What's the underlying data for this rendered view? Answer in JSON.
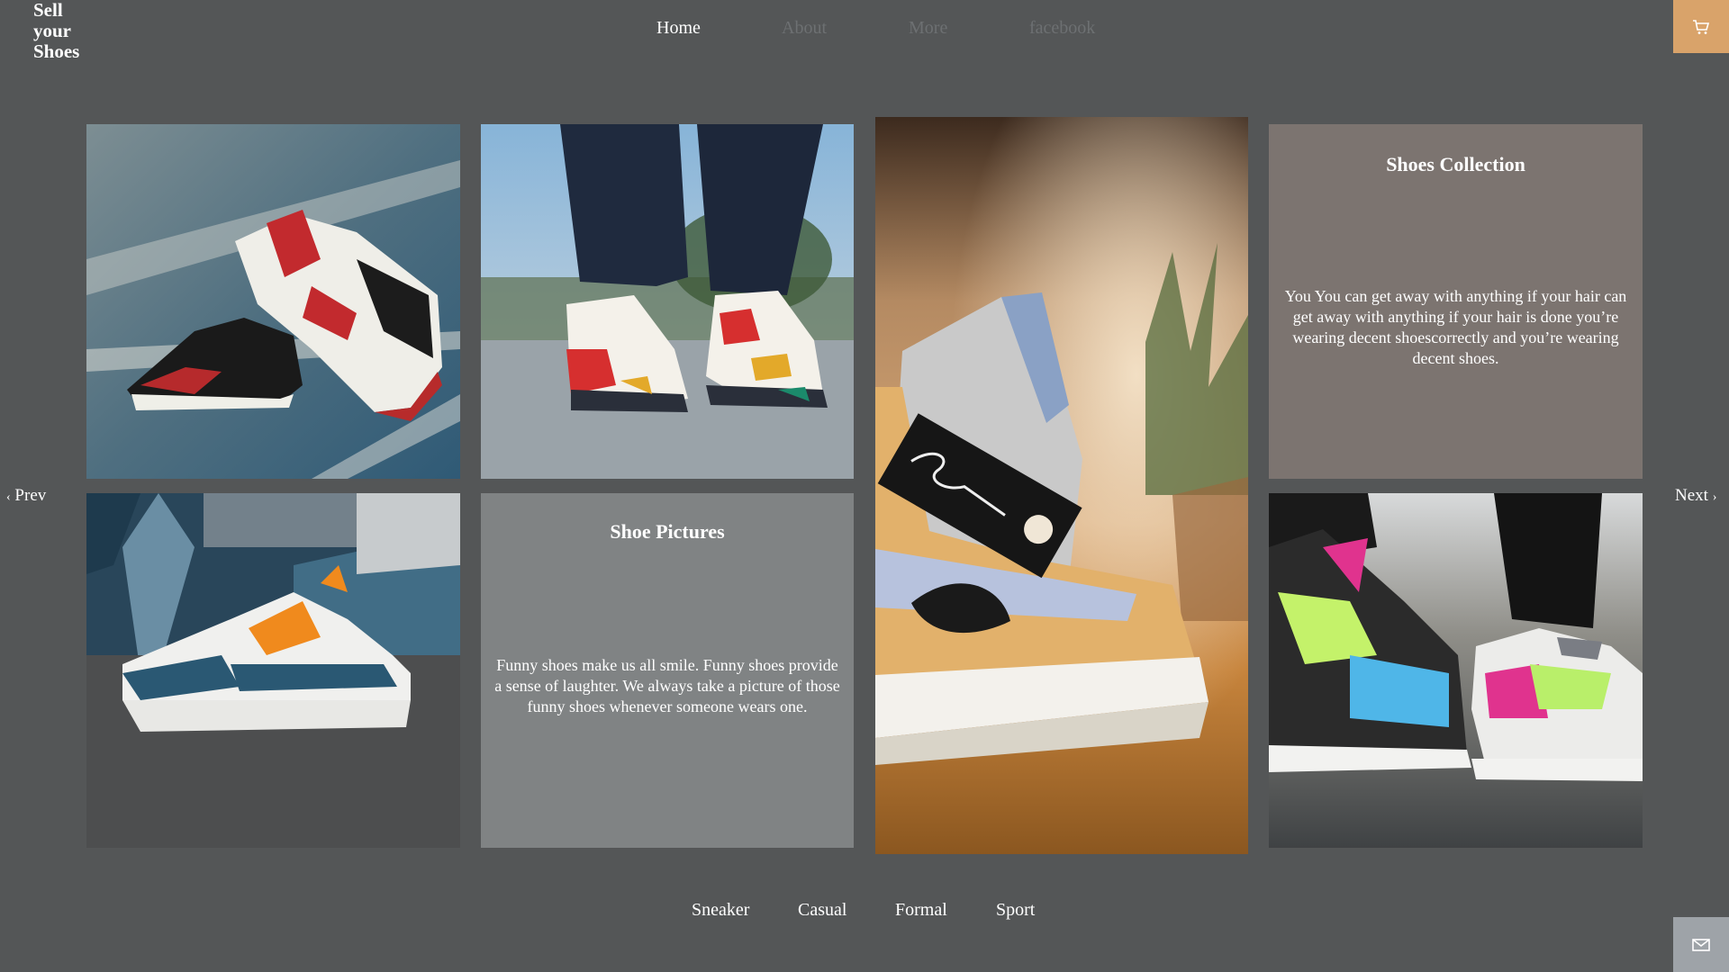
{
  "brand": {
    "line1": "Sell",
    "line2": "your",
    "line3": "Shoes"
  },
  "nav": {
    "home": "Home",
    "about": "About",
    "more": "More",
    "facebook": "facebook"
  },
  "pager": {
    "prev": "Prev",
    "next": "Next",
    "prev_glyph": "‹",
    "next_glyph": "›"
  },
  "cards": {
    "collection": {
      "title": "Shoes Collection",
      "text": "You You can get away with anything if your hair can get away with anything if your hair is done you’re wearing decent shoescorrectly and you’re wearing decent shoes."
    },
    "pictures": {
      "title": "Shoe Pictures",
      "text": "Funny shoes make us all smile. Funny shoes provide a sense of laughter. We always take a picture of those funny shoes whenever someone wears one."
    }
  },
  "categories": {
    "sneaker": "Sneaker",
    "casual": "Casual",
    "formal": "Formal",
    "sport": "Sport"
  },
  "colors": {
    "background": "#545657",
    "cart_accent": "#d9a36a",
    "mail_accent": "#9ea3a8",
    "collection_card": "#7c7470",
    "pictures_card": "#808384",
    "nav_inactive": "#6d7072"
  },
  "icons": {
    "cart": "cart-icon",
    "mail": "mail-icon"
  }
}
